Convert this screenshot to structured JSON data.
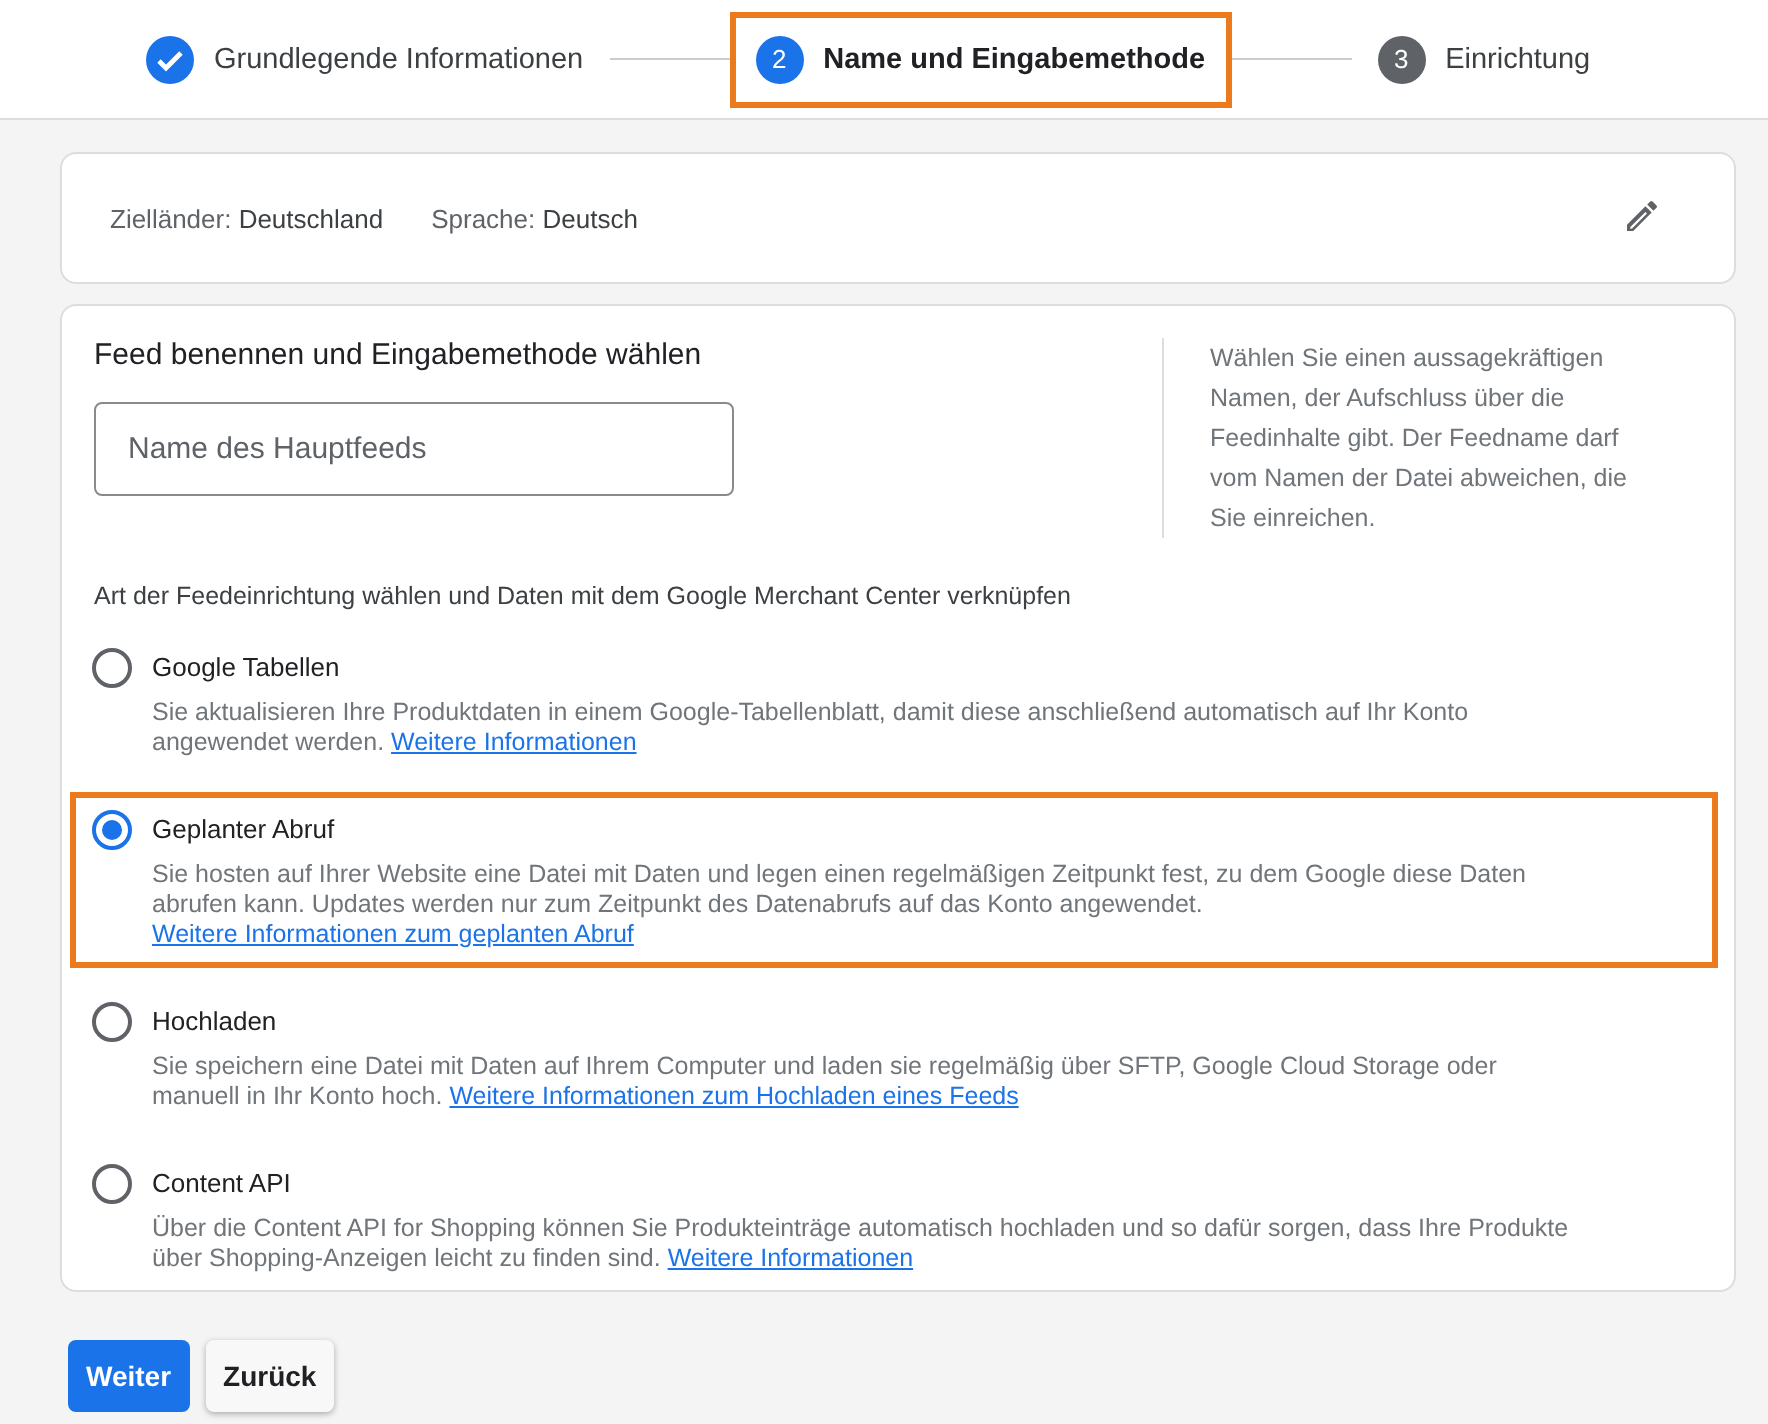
{
  "stepper": [
    {
      "label": "Grundlegende Informationen",
      "completed": true,
      "selected": false,
      "highlighted": false
    },
    {
      "label": "Name und Eingabemethode",
      "completed": false,
      "selected": true,
      "number": "2",
      "highlighted": true
    },
    {
      "label": "Einrichtung",
      "completed": false,
      "selected": false,
      "number": "3",
      "highlighted": false
    }
  ],
  "summary": {
    "fields": [
      {
        "label": "Zielländer:",
        "value": "Deutschland"
      },
      {
        "label": "Sprache:",
        "value": "Deutsch"
      }
    ]
  },
  "form": {
    "title": "Feed benennen und Eingabemethode wählen",
    "name_field": {
      "placeholder": "Name des Hauptfeeds"
    },
    "help": "Wählen Sie einen aussagekräftigen Namen, der Aufschluss über die Feedinhalte gibt. Der Feedname darf vom Namen der Datei abweichen, die Sie einreichen.",
    "method_label": "Art der Feedeinrichtung wählen und Daten mit dem Google Merchant Center verknüpfen",
    "options": [
      {
        "label": "Google Tabellen",
        "selected": false,
        "highlighted": false,
        "description": "Sie aktualisieren Ihre Produktdaten in einem Google-Tabellenblatt, damit diese anschließend automatisch auf Ihr Konto angewendet werden.",
        "link": "Weitere Informationen"
      },
      {
        "label": "Geplanter Abruf",
        "selected": true,
        "highlighted": true,
        "description": "Sie hosten auf Ihrer Website eine Datei mit Daten und legen einen regelmäßigen Zeitpunkt fest, zu dem Google diese Daten abrufen kann. Updates werden nur zum Zeitpunkt des Datenabrufs auf das Konto angewendet.",
        "link": "Weitere Informationen zum geplanten Abruf"
      },
      {
        "label": "Hochladen",
        "selected": false,
        "highlighted": false,
        "description": "Sie speichern eine Datei mit Daten auf Ihrem Computer und laden sie regelmäßig über SFTP, Google Cloud Storage oder manuell in Ihr Konto hoch.",
        "link": "Weitere Informationen zum Hochladen eines Feeds"
      },
      {
        "label": "Content API",
        "selected": false,
        "highlighted": false,
        "description": "Über die Content API for Shopping können Sie Produkteinträge automatisch hochladen und so dafür sorgen, dass Ihre Produkte über Shopping-Anzeigen leicht zu finden sind.",
        "link": "Weitere Informationen"
      }
    ]
  },
  "buttons": [
    {
      "label": "Weiter",
      "kind": "primary"
    },
    {
      "label": "Zurück",
      "kind": "secondary"
    }
  ]
}
